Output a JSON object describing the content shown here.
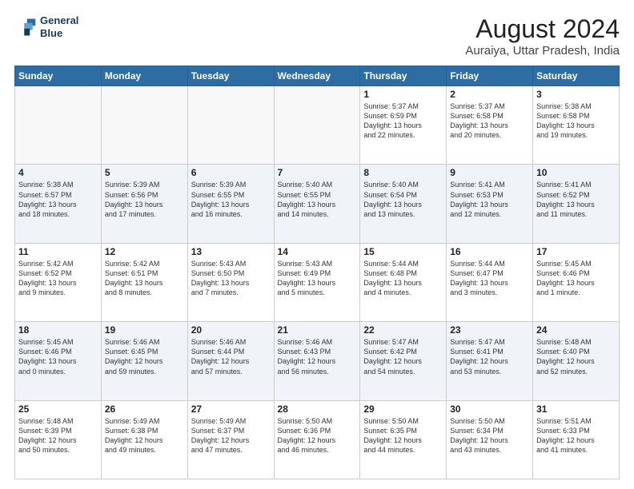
{
  "logo": {
    "line1": "General",
    "line2": "Blue"
  },
  "title": "August 2024",
  "subtitle": "Auraiya, Uttar Pradesh, India",
  "days_of_week": [
    "Sunday",
    "Monday",
    "Tuesday",
    "Wednesday",
    "Thursday",
    "Friday",
    "Saturday"
  ],
  "weeks": [
    [
      {
        "day": "",
        "info": ""
      },
      {
        "day": "",
        "info": ""
      },
      {
        "day": "",
        "info": ""
      },
      {
        "day": "",
        "info": ""
      },
      {
        "day": "1",
        "info": "Sunrise: 5:37 AM\nSunset: 6:59 PM\nDaylight: 13 hours\nand 22 minutes."
      },
      {
        "day": "2",
        "info": "Sunrise: 5:37 AM\nSunset: 6:58 PM\nDaylight: 13 hours\nand 20 minutes."
      },
      {
        "day": "3",
        "info": "Sunrise: 5:38 AM\nSunset: 6:58 PM\nDaylight: 13 hours\nand 19 minutes."
      }
    ],
    [
      {
        "day": "4",
        "info": "Sunrise: 5:38 AM\nSunset: 6:57 PM\nDaylight: 13 hours\nand 18 minutes."
      },
      {
        "day": "5",
        "info": "Sunrise: 5:39 AM\nSunset: 6:56 PM\nDaylight: 13 hours\nand 17 minutes."
      },
      {
        "day": "6",
        "info": "Sunrise: 5:39 AM\nSunset: 6:55 PM\nDaylight: 13 hours\nand 16 minutes."
      },
      {
        "day": "7",
        "info": "Sunrise: 5:40 AM\nSunset: 6:55 PM\nDaylight: 13 hours\nand 14 minutes."
      },
      {
        "day": "8",
        "info": "Sunrise: 5:40 AM\nSunset: 6:54 PM\nDaylight: 13 hours\nand 13 minutes."
      },
      {
        "day": "9",
        "info": "Sunrise: 5:41 AM\nSunset: 6:53 PM\nDaylight: 13 hours\nand 12 minutes."
      },
      {
        "day": "10",
        "info": "Sunrise: 5:41 AM\nSunset: 6:52 PM\nDaylight: 13 hours\nand 11 minutes."
      }
    ],
    [
      {
        "day": "11",
        "info": "Sunrise: 5:42 AM\nSunset: 6:52 PM\nDaylight: 13 hours\nand 9 minutes."
      },
      {
        "day": "12",
        "info": "Sunrise: 5:42 AM\nSunset: 6:51 PM\nDaylight: 13 hours\nand 8 minutes."
      },
      {
        "day": "13",
        "info": "Sunrise: 5:43 AM\nSunset: 6:50 PM\nDaylight: 13 hours\nand 7 minutes."
      },
      {
        "day": "14",
        "info": "Sunrise: 5:43 AM\nSunset: 6:49 PM\nDaylight: 13 hours\nand 5 minutes."
      },
      {
        "day": "15",
        "info": "Sunrise: 5:44 AM\nSunset: 6:48 PM\nDaylight: 13 hours\nand 4 minutes."
      },
      {
        "day": "16",
        "info": "Sunrise: 5:44 AM\nSunset: 6:47 PM\nDaylight: 13 hours\nand 3 minutes."
      },
      {
        "day": "17",
        "info": "Sunrise: 5:45 AM\nSunset: 6:46 PM\nDaylight: 13 hours\nand 1 minute."
      }
    ],
    [
      {
        "day": "18",
        "info": "Sunrise: 5:45 AM\nSunset: 6:46 PM\nDaylight: 13 hours\nand 0 minutes."
      },
      {
        "day": "19",
        "info": "Sunrise: 5:46 AM\nSunset: 6:45 PM\nDaylight: 12 hours\nand 59 minutes."
      },
      {
        "day": "20",
        "info": "Sunrise: 5:46 AM\nSunset: 6:44 PM\nDaylight: 12 hours\nand 57 minutes."
      },
      {
        "day": "21",
        "info": "Sunrise: 5:46 AM\nSunset: 6:43 PM\nDaylight: 12 hours\nand 56 minutes."
      },
      {
        "day": "22",
        "info": "Sunrise: 5:47 AM\nSunset: 6:42 PM\nDaylight: 12 hours\nand 54 minutes."
      },
      {
        "day": "23",
        "info": "Sunrise: 5:47 AM\nSunset: 6:41 PM\nDaylight: 12 hours\nand 53 minutes."
      },
      {
        "day": "24",
        "info": "Sunrise: 5:48 AM\nSunset: 6:40 PM\nDaylight: 12 hours\nand 52 minutes."
      }
    ],
    [
      {
        "day": "25",
        "info": "Sunrise: 5:48 AM\nSunset: 6:39 PM\nDaylight: 12 hours\nand 50 minutes."
      },
      {
        "day": "26",
        "info": "Sunrise: 5:49 AM\nSunset: 6:38 PM\nDaylight: 12 hours\nand 49 minutes."
      },
      {
        "day": "27",
        "info": "Sunrise: 5:49 AM\nSunset: 6:37 PM\nDaylight: 12 hours\nand 47 minutes."
      },
      {
        "day": "28",
        "info": "Sunrise: 5:50 AM\nSunset: 6:36 PM\nDaylight: 12 hours\nand 46 minutes."
      },
      {
        "day": "29",
        "info": "Sunrise: 5:50 AM\nSunset: 6:35 PM\nDaylight: 12 hours\nand 44 minutes."
      },
      {
        "day": "30",
        "info": "Sunrise: 5:50 AM\nSunset: 6:34 PM\nDaylight: 12 hours\nand 43 minutes."
      },
      {
        "day": "31",
        "info": "Sunrise: 5:51 AM\nSunset: 6:33 PM\nDaylight: 12 hours\nand 41 minutes."
      }
    ]
  ]
}
